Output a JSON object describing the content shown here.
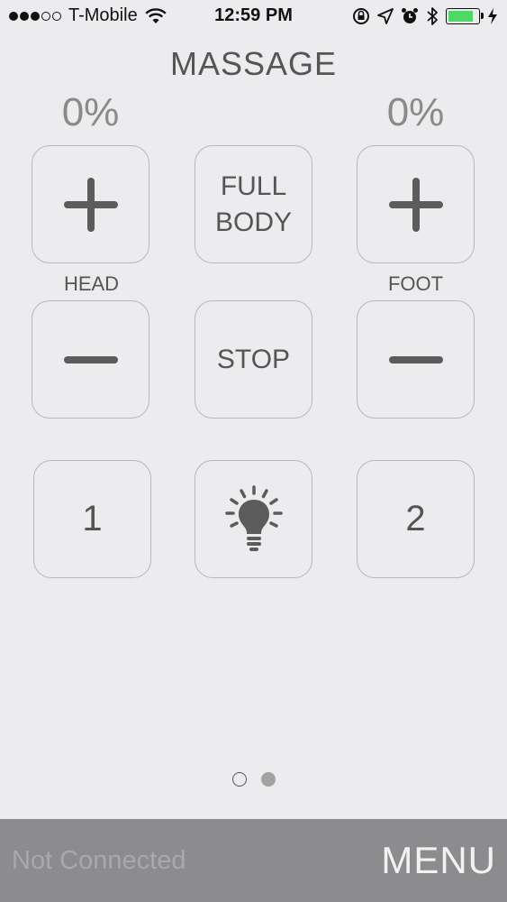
{
  "status_bar": {
    "carrier": "T-Mobile",
    "time": "12:59 PM",
    "signal_bars_filled": 3,
    "signal_bars_total": 5,
    "battery_level": 0.85,
    "battery_color": "#4cd964"
  },
  "header": {
    "title": "MASSAGE",
    "head_percent": "0%",
    "foot_percent": "0%"
  },
  "controls": {
    "head_label": "HEAD",
    "foot_label": "FOOT",
    "full_body_line1": "FULL",
    "full_body_line2": "BODY",
    "stop_label": "STOP",
    "preset1_label": "1",
    "preset2_label": "2",
    "light_icon": "lightbulb-icon"
  },
  "pager": {
    "page_count": 2,
    "current_page": 2
  },
  "bottom_bar": {
    "connection_status": "Not Connected",
    "menu_label": "MENU"
  }
}
